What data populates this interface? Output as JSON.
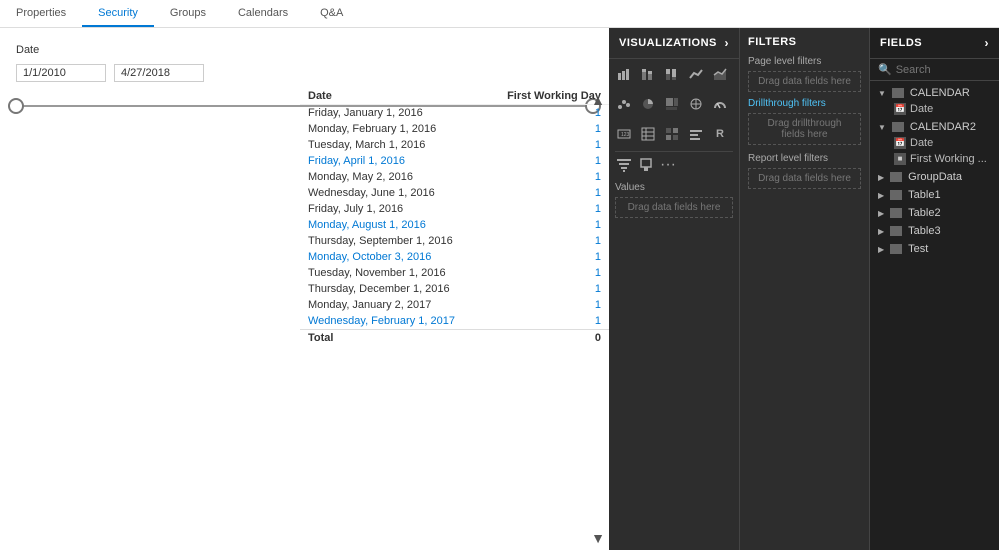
{
  "tabs": [
    {
      "id": "properties",
      "label": "Properties",
      "active": false
    },
    {
      "id": "security",
      "label": "Security",
      "active": false
    },
    {
      "id": "groups",
      "label": "Groups",
      "active": false
    },
    {
      "id": "calendars",
      "label": "Calendars",
      "active": true
    },
    {
      "id": "qa",
      "label": "Q&A",
      "active": false
    }
  ],
  "date_filter": {
    "label": "Date",
    "start_value": "1/1/2010",
    "end_value": "4/27/2018"
  },
  "table": {
    "headers": [
      "Date",
      "First Working Day"
    ],
    "rows": [
      {
        "date": "Friday, January 1, 2016",
        "value": "1",
        "highlighted": false
      },
      {
        "date": "Monday, February 1, 2016",
        "value": "1",
        "highlighted": false
      },
      {
        "date": "Tuesday, March 1, 2016",
        "value": "1",
        "highlighted": false
      },
      {
        "date": "Friday, April 1, 2016",
        "value": "1",
        "highlighted": true
      },
      {
        "date": "Monday, May 2, 2016",
        "value": "1",
        "highlighted": false
      },
      {
        "date": "Wednesday, June 1, 2016",
        "value": "1",
        "highlighted": false
      },
      {
        "date": "Friday, July 1, 2016",
        "value": "1",
        "highlighted": false
      },
      {
        "date": "Monday, August 1, 2016",
        "value": "1",
        "highlighted": true
      },
      {
        "date": "Thursday, September 1, 2016",
        "value": "1",
        "highlighted": false
      },
      {
        "date": "Monday, October 3, 2016",
        "value": "1",
        "highlighted": true
      },
      {
        "date": "Tuesday, November 1, 2016",
        "value": "1",
        "highlighted": false
      },
      {
        "date": "Thursday, December 1, 2016",
        "value": "1",
        "highlighted": false
      },
      {
        "date": "Monday, January 2, 2017",
        "value": "1",
        "highlighted": false
      },
      {
        "date": "Wednesday, February 1, 2017",
        "value": "1",
        "highlighted": true
      }
    ],
    "total_label": "Total",
    "total_value": "0"
  },
  "visualizations": {
    "header": "VISUALIZATIONS",
    "values_label": "Values",
    "drag_values": "Drag data fields here"
  },
  "filters": {
    "header": "FILTERS",
    "page_level": "Page level filters",
    "drag_page": "Drag data fields here",
    "drillthrough": "Drillthrough filters",
    "drag_drillthrough": "Drag drillthrough fields here",
    "report_level": "Report level filters",
    "drag_report": "Drag data fields here"
  },
  "fields": {
    "header": "FIELDS",
    "search_placeholder": "Search",
    "groups": [
      {
        "name": "CALENDAR",
        "expanded": true,
        "items": [
          {
            "name": "Date",
            "type": "date"
          }
        ]
      },
      {
        "name": "CALENDAR2",
        "expanded": true,
        "items": [
          {
            "name": "Date",
            "type": "date"
          },
          {
            "name": "First Working ...",
            "type": "field"
          }
        ]
      },
      {
        "name": "GroupData",
        "expanded": false,
        "items": []
      },
      {
        "name": "Table1",
        "expanded": false,
        "items": []
      },
      {
        "name": "Table2",
        "expanded": false,
        "items": []
      },
      {
        "name": "Table3",
        "expanded": false,
        "items": []
      },
      {
        "name": "Test",
        "expanded": false,
        "items": []
      }
    ]
  }
}
